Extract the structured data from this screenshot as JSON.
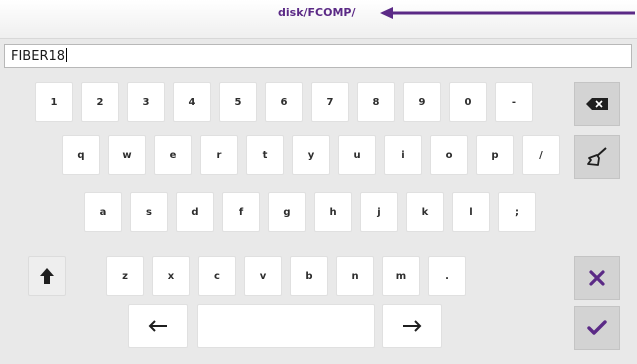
{
  "header": {
    "path": "disk/FCOMP/",
    "accent_color": "#5b2a86"
  },
  "input": {
    "value": "FIBER18"
  },
  "keyboard": {
    "row1": [
      "1",
      "2",
      "3",
      "4",
      "5",
      "6",
      "7",
      "8",
      "9",
      "0",
      "-"
    ],
    "row2": [
      "q",
      "w",
      "e",
      "r",
      "t",
      "y",
      "u",
      "i",
      "o",
      "p",
      "/"
    ],
    "row3": [
      "a",
      "s",
      "d",
      "f",
      "g",
      "h",
      "j",
      "k",
      "l",
      ";"
    ],
    "row4": [
      "z",
      "x",
      "c",
      "v",
      "b",
      "n",
      "m",
      "."
    ]
  },
  "icons": {
    "backspace": "backspace-icon",
    "clear": "broom-icon",
    "shift": "shift-up-arrow-icon",
    "cursor_left": "left-arrow-icon",
    "cursor_right": "right-arrow-icon",
    "cancel": "close-icon",
    "confirm": "checkmark-icon"
  }
}
